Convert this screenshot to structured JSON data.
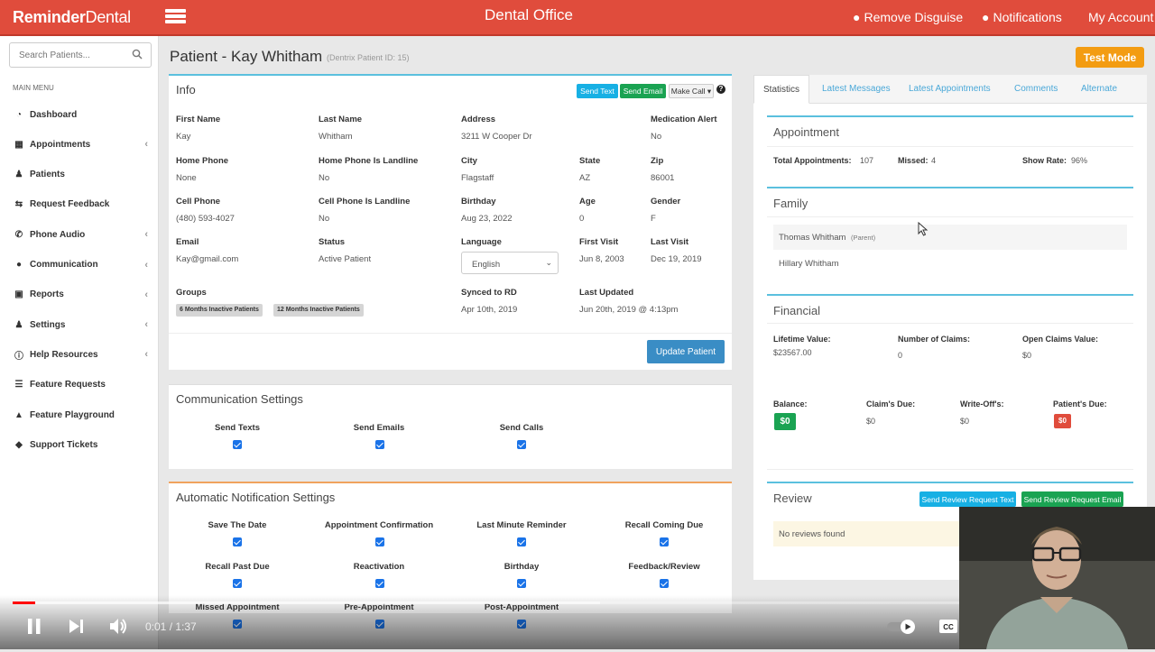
{
  "topbar": {
    "logo_bold": "Reminder",
    "logo_rest": "Dental",
    "office": "Dental Office",
    "remove_disguise": "Remove Disguise",
    "notifications": "Notifications",
    "my_account": "My Account",
    "color": "#e04c3c"
  },
  "sidebar": {
    "search_placeholder": "Search Patients...",
    "menu_label": "MAIN MENU",
    "items": [
      {
        "label": "Dashboard",
        "icon": "dashboard-icon",
        "chevron": false
      },
      {
        "label": "Appointments",
        "icon": "calendar-icon",
        "chevron": true
      },
      {
        "label": "Patients",
        "icon": "users-icon",
        "chevron": false
      },
      {
        "label": "Request Feedback",
        "icon": "retweet-icon",
        "chevron": false
      },
      {
        "label": "Phone Audio",
        "icon": "phone-icon",
        "chevron": true
      },
      {
        "label": "Communication",
        "icon": "comments-icon",
        "chevron": true
      },
      {
        "label": "Reports",
        "icon": "book-icon",
        "chevron": true
      },
      {
        "label": "Settings",
        "icon": "user-icon",
        "chevron": true
      },
      {
        "label": "Help Resources",
        "icon": "info-icon",
        "chevron": true
      },
      {
        "label": "Feature Requests",
        "icon": "list-icon",
        "chevron": false
      },
      {
        "label": "Feature Playground",
        "icon": "flask-icon",
        "chevron": false
      },
      {
        "label": "Support Tickets",
        "icon": "ticket-icon",
        "chevron": false
      }
    ]
  },
  "page": {
    "title": "Patient - Kay Whitham",
    "subtitle": "(Dentrix Patient ID: 15)",
    "test_mode": "Test Mode"
  },
  "info": {
    "heading": "Info",
    "send_text": "Send Text",
    "send_email": "Send Email",
    "make_call": "Make Call ▾",
    "help": "?",
    "fields": {
      "first_name_l": "First Name",
      "first_name": "Kay",
      "last_name_l": "Last Name",
      "last_name": "Whitham",
      "address_l": "Address",
      "address": "3211 W Cooper Dr",
      "med_alert_l": "Medication Alert",
      "med_alert": "No",
      "home_phone_l": "Home Phone",
      "home_phone": "None",
      "home_landline_l": "Home Phone Is Landline",
      "home_landline": "No",
      "city_l": "City",
      "city": "Flagstaff",
      "state_l": "State",
      "state": "AZ",
      "zip_l": "Zip",
      "zip": "86001",
      "cell_phone_l": "Cell Phone",
      "cell_phone": "(480) 593-4027",
      "cell_landline_l": "Cell Phone Is Landline",
      "cell_landline": "No",
      "birthday_l": "Birthday",
      "birthday": "Aug 23, 2022",
      "age_l": "Age",
      "age": "0",
      "gender_l": "Gender",
      "gender": "F",
      "email_l": "Email",
      "email": "Kay@gmail.com",
      "status_l": "Status",
      "status": "Active Patient",
      "language_l": "Language",
      "language": "English",
      "first_visit_l": "First Visit",
      "first_visit": "Jun 8, 2003",
      "last_visit_l": "Last Visit",
      "last_visit": "Dec 19, 2019",
      "groups_l": "Groups",
      "group1": "6 Months Inactive Patients",
      "group2": "12 Months Inactive Patients",
      "synced_l": "Synced to RD",
      "synced": "Apr 10th, 2019",
      "updated_l": "Last Updated",
      "updated": "Jun 20th, 2019 @ 4:13pm"
    },
    "update_button": "Update Patient"
  },
  "comm": {
    "heading": "Communication Settings",
    "send_texts": "Send Texts",
    "send_emails": "Send Emails",
    "send_calls": "Send Calls"
  },
  "autonotif": {
    "heading": "Automatic Notification Settings",
    "items": [
      "Save The Date",
      "Appointment Confirmation",
      "Last Minute Reminder",
      "Recall Coming Due",
      "Recall Past Due",
      "Reactivation",
      "Birthday",
      "Feedback/Review",
      "Missed Appointment",
      "Pre-Appointment",
      "Post-Appointment"
    ]
  },
  "tabs": [
    "Statistics",
    "Latest Messages",
    "Latest Appointments",
    "Comments",
    "Alternate"
  ],
  "stats": {
    "appt_heading": "Appointment",
    "total_l": "Total Appointments:",
    "total": "107",
    "missed_l": "Missed:",
    "missed": "4",
    "show_l": "Show Rate:",
    "show": "96%",
    "family_heading": "Family",
    "family1": "Thomas Whitham",
    "family1_tag": "(Parent)",
    "family2": "Hillary Whitham",
    "fin_heading": "Financial",
    "lifetime_l": "Lifetime Value:",
    "lifetime": "$23567.00",
    "claims_l": "Number of Claims:",
    "claims": "0",
    "open_l": "Open Claims Value:",
    "open": "$0",
    "balance_l": "Balance:",
    "balance": "$0",
    "claimdue_l": "Claim's Due:",
    "claimdue": "$0",
    "writeoff_l": "Write-Off's:",
    "writeoff": "$0",
    "ptdue_l": "Patient's Due:",
    "ptdue": "$0",
    "review_heading": "Review",
    "send_review_text": "Send Review Request Text",
    "send_review_email": "Send Review Request Email",
    "no_reviews": "No reviews found"
  },
  "video": {
    "time": "0:01 / 1:37",
    "progress": 0.02,
    "buffered": 0.52
  }
}
